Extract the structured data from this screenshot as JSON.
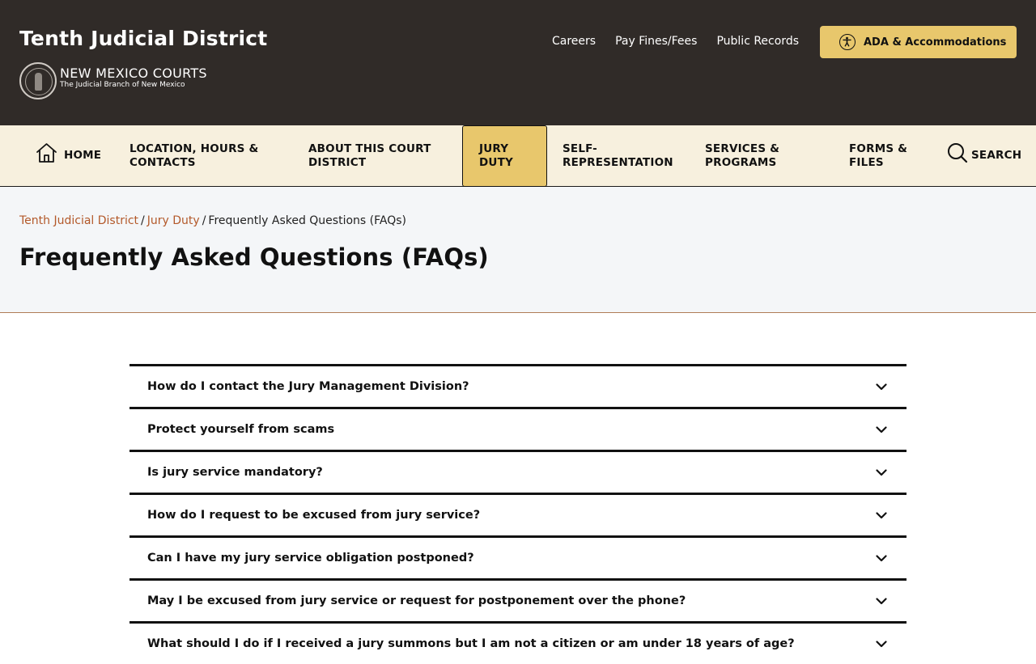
{
  "header": {
    "site_title": "Tenth Judicial District",
    "brand_name": "NEW MEXICO COURTS",
    "brand_subtitle": "The Judicial Branch of New Mexico",
    "utility_links": [
      "Careers",
      "Pay Fines/Fees",
      "Public Records"
    ],
    "ada_button": "ADA & Accommodations",
    "colors": {
      "background": "#302b28",
      "accent": "#e8c76c"
    }
  },
  "nav": {
    "home": "HOME",
    "location": "LOCATION, HOURS & CONTACTS",
    "about": "ABOUT THIS COURT DISTRICT",
    "jury": "JURY DUTY",
    "self_rep": "SELF-REPRESENTATION",
    "services": "SERVICES & PROGRAMS",
    "forms": "FORMS & FILES",
    "search": "SEARCH",
    "active": "JURY DUTY"
  },
  "breadcrumb": {
    "items": [
      "Tenth Judicial District",
      "Jury Duty"
    ],
    "separator": "/",
    "current": "Frequently Asked Questions (FAQs)"
  },
  "page": {
    "title": "Frequently Asked Questions (FAQs)"
  },
  "faq": [
    "How do I contact the Jury Management Division?",
    "Protect yourself from scams",
    "Is jury service mandatory?",
    "How do I request to be excused from jury service?",
    "Can I have my jury service obligation postponed?",
    "May I be excused from jury service or request for postponement over the phone?",
    "What should I do if I received a jury summons but I am not a citizen or am under 18 years of age?"
  ],
  "icons": {
    "home": "home-icon",
    "search": "search-icon",
    "accessibility": "accessibility-icon",
    "chevron": "chevron-down-icon"
  }
}
